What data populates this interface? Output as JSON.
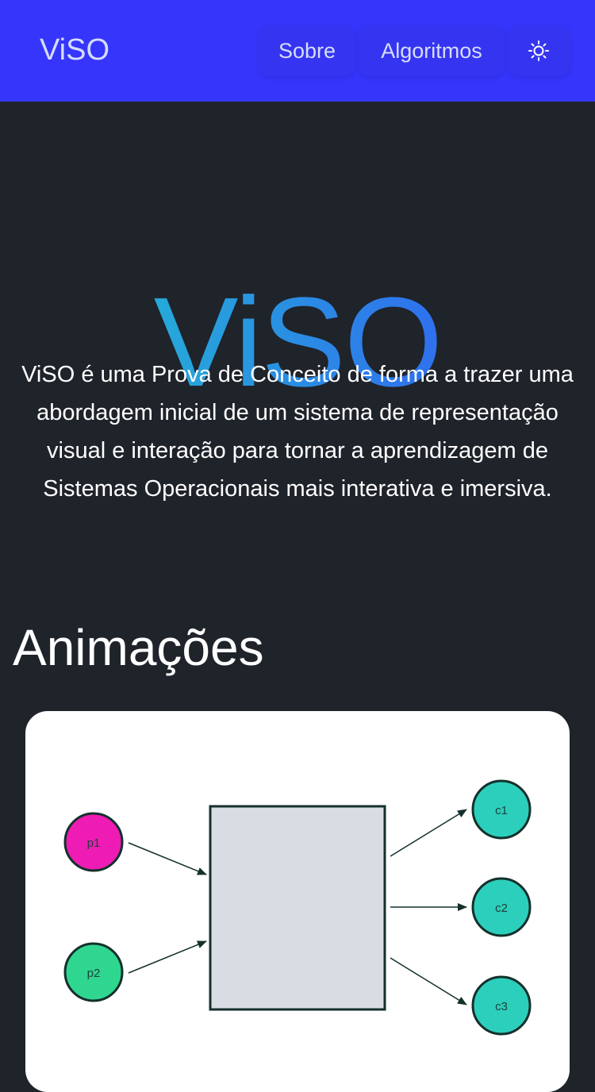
{
  "navbar": {
    "brand": "ViSO",
    "links": [
      {
        "label": "Sobre"
      },
      {
        "label": "Algoritmos"
      }
    ],
    "theme_icon": "sun-icon",
    "colors": {
      "background": "#3535fb",
      "text": "#d6ddff"
    }
  },
  "hero": {
    "title": "ViSO",
    "description": "ViSO é uma Prova de Conceito de forma a trazer uma abordagem inicial de um sistema de representação visual e interação para tornar a aprendizagem de Sistemas Operacionais mais interativa e imersiva."
  },
  "animations": {
    "section_title": "Animações",
    "diagram": {
      "producers": [
        {
          "label": "p1",
          "color": "#ee1cb4"
        },
        {
          "label": "p2",
          "color": "#2fd68f"
        }
      ],
      "consumers": [
        {
          "label": "c1",
          "color": "#2ccfbc"
        },
        {
          "label": "c2",
          "color": "#2ccfbc"
        },
        {
          "label": "c3",
          "color": "#2ccfbc"
        }
      ],
      "buffer_color": "#d8dde4"
    }
  },
  "theme": {
    "page_background": "#1f232a",
    "gradient": [
      "#26a9d9",
      "#2f70ee"
    ]
  }
}
